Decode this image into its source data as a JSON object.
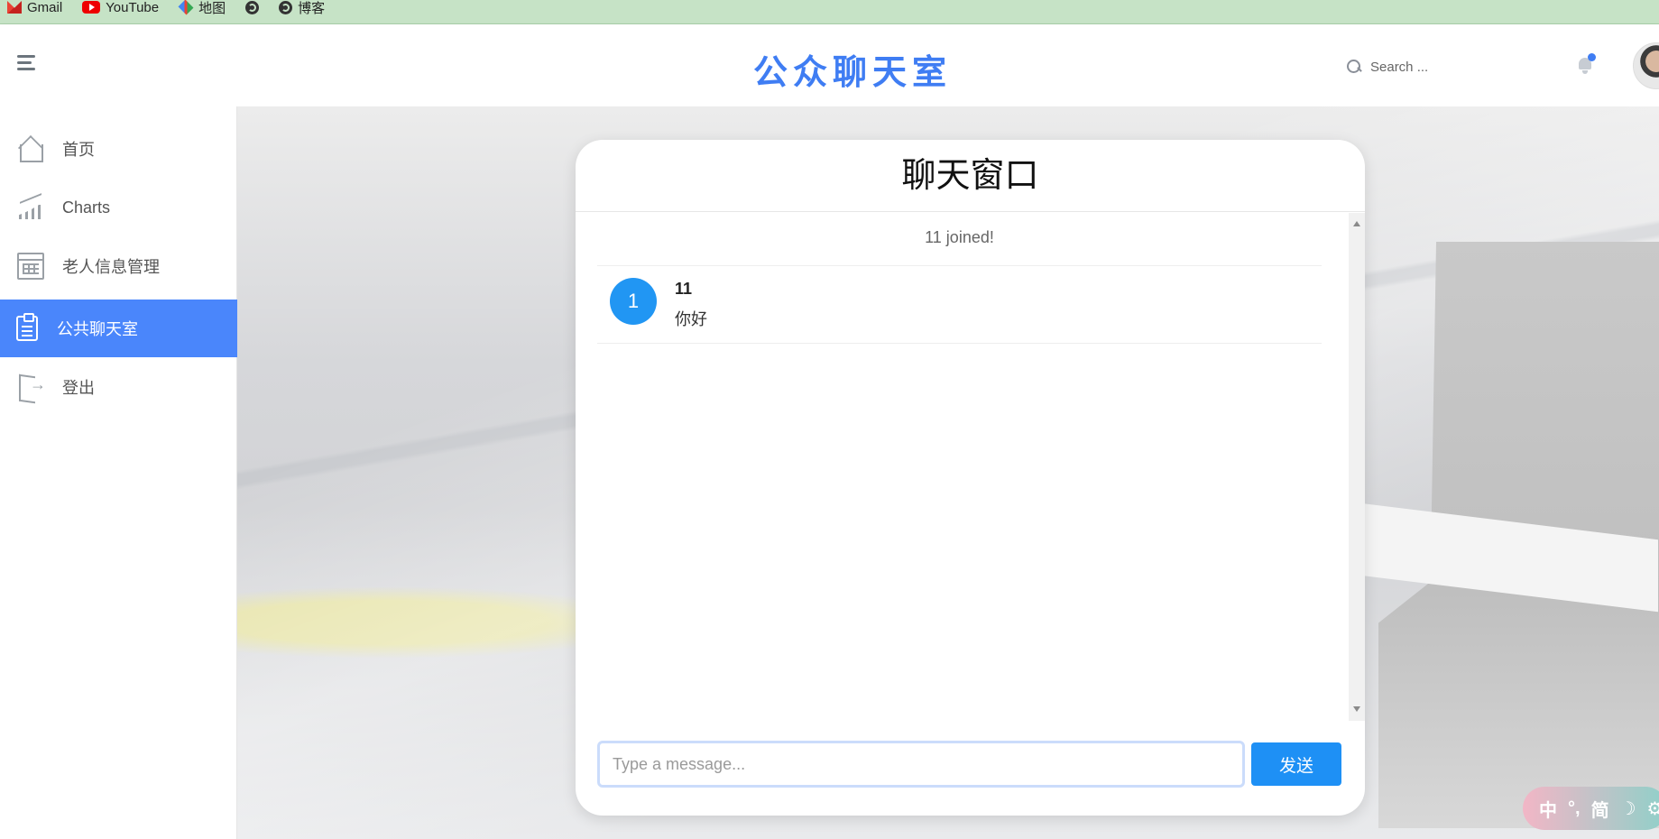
{
  "bookmarks": [
    {
      "label": "Gmail",
      "icon": "gmail-icon"
    },
    {
      "label": "YouTube",
      "icon": "youtube-icon"
    },
    {
      "label": "地图",
      "icon": "maps-icon"
    },
    {
      "label": "",
      "icon": "globe-icon"
    },
    {
      "label": "博客",
      "icon": "globe-icon"
    }
  ],
  "header": {
    "title": "公众聊天室",
    "search_placeholder": "Search ...",
    "menu_icon": "hamburger-icon",
    "notification_icon": "bell-icon",
    "accent_color": "#3f7df3"
  },
  "sidebar": {
    "items": [
      {
        "label": "首页",
        "icon": "home-icon",
        "active": false
      },
      {
        "label": "Charts",
        "icon": "chart-icon",
        "active": false
      },
      {
        "label": "老人信息管理",
        "icon": "table-icon",
        "active": false
      },
      {
        "label": "公共聊天室",
        "icon": "clipboard-icon",
        "active": true
      },
      {
        "label": "登出",
        "icon": "logout-icon",
        "active": false
      }
    ],
    "active_color": "#4a86fb"
  },
  "chat": {
    "title": "聊天窗口",
    "system_message": "11 joined!",
    "messages": [
      {
        "avatar_letter": "1",
        "user": "11",
        "text": "你好"
      }
    ],
    "input_placeholder": "Type a message...",
    "send_label": "发送",
    "send_color": "#1e90f5"
  },
  "ime": {
    "mode": "中",
    "punct": "°,",
    "script": "简",
    "theme": "☽",
    "settings": "⚙"
  }
}
